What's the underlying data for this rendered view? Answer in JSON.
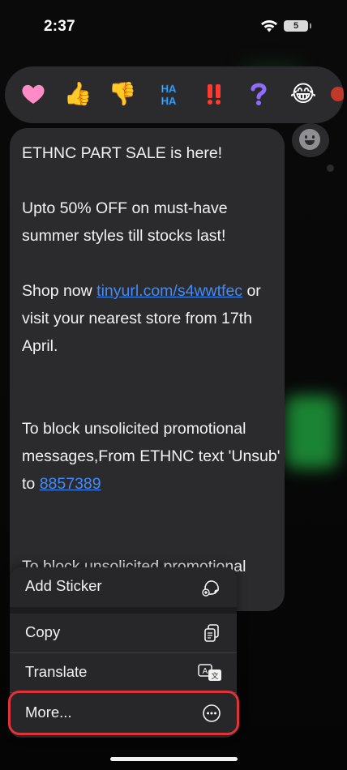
{
  "status_bar": {
    "time": "2:37",
    "battery_level": "5"
  },
  "reactions": [
    {
      "icon": "heart-emoji",
      "glyph": "🩷"
    },
    {
      "icon": "thumbs-up-emoji",
      "glyph": "👍"
    },
    {
      "icon": "thumbs-down-emoji",
      "glyph": "👎"
    },
    {
      "icon": "haha-emoji",
      "glyph": "HA HA"
    },
    {
      "icon": "exclamation-emoji",
      "glyph": "‼️"
    },
    {
      "icon": "question-emoji",
      "glyph": "❓"
    },
    {
      "icon": "laughing-emoji",
      "glyph": "😂"
    },
    {
      "icon": "more-reaction-emoji",
      "glyph": ""
    }
  ],
  "message": {
    "line1": "ETHNC PART SALE is here!",
    "line2": "Upto 50% OFF on must-have summer styles till stocks last!",
    "line3_prefix": "Shop now ",
    "line3_link": "tinyurl.com/s4wwtfec",
    "line3_suffix": " or visit your nearest store from 17th April.",
    "line4_prefix": "To block unsolicited promotional messages,From ETHNC text 'Unsub' to ",
    "line4_link": "8857389",
    "line5_partial": "To block unsolicited promotional"
  },
  "menu": {
    "add_sticker": "Add Sticker",
    "copy": "Copy",
    "translate": "Translate",
    "more": "More..."
  },
  "colors": {
    "link": "#3f8cff",
    "highlight": "#e0323a",
    "bubble": "#2b2b2d"
  }
}
